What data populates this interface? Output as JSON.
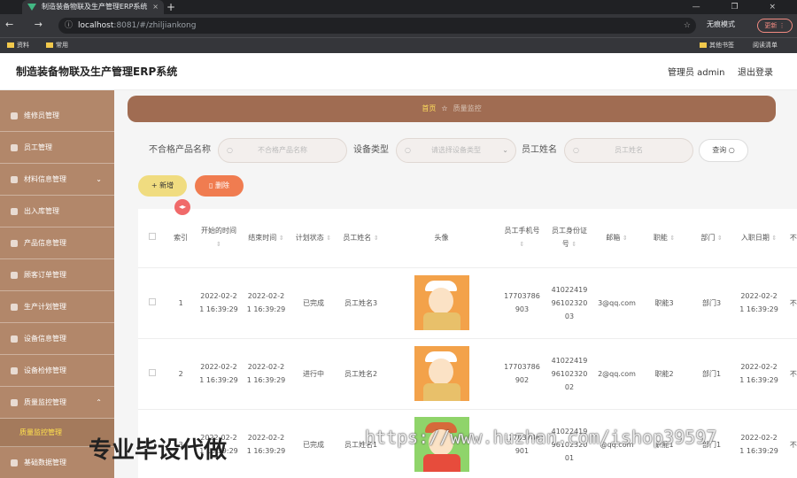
{
  "browser": {
    "tab_title": "制造装备物联及生产管理ERP系统",
    "tab_close": "×",
    "new_tab": "+",
    "window_controls": "—  ❐  ×",
    "nav": "← → ⟳",
    "url_host": "localhost",
    "url_path": ":8081/#/zhiljiankong",
    "info_icon": "ⓘ",
    "star_icon": "☆",
    "incognito_label": "无痕模式",
    "update_label": "更新 ⋮",
    "bookmarks": [
      {
        "label": "资料"
      },
      {
        "label": "常用"
      }
    ],
    "bookmarks_right": [
      {
        "label": "其他书签"
      },
      {
        "label": "阅读清单"
      }
    ]
  },
  "header": {
    "title": "制造装备物联及生产管理ERP系统",
    "admin": "管理员 admin",
    "logout": "退出登录"
  },
  "sidebar": {
    "items": [
      {
        "label": "维修员管理",
        "chevron": ""
      },
      {
        "label": "员工管理",
        "chevron": ""
      },
      {
        "label": "材料信息管理",
        "chevron": "⌄"
      },
      {
        "label": "出入库管理",
        "chevron": ""
      },
      {
        "label": "产品信息管理",
        "chevron": ""
      },
      {
        "label": "顾客订单管理",
        "chevron": ""
      },
      {
        "label": "生产计划管理",
        "chevron": ""
      },
      {
        "label": "设备信息管理",
        "chevron": ""
      },
      {
        "label": "设备检修管理",
        "chevron": ""
      },
      {
        "label": "质量监控管理",
        "chevron": "⌃"
      }
    ],
    "active_sub": "质量监控管理",
    "last_item": {
      "label": "基础数据管理",
      "chevron": ""
    }
  },
  "breadcrumb": {
    "home": "首页",
    "star": "☆",
    "current": "质量监控"
  },
  "search": {
    "label_product": "不合格产品名称",
    "placeholder_product": "不合格产品名称",
    "label_type": "设备类型",
    "placeholder_type": "请选择设备类型",
    "label_staff": "员工姓名",
    "placeholder_staff": "员工姓名",
    "query": "查询 ○",
    "mag_icon": "○",
    "dd_icon": "⌄"
  },
  "actions": {
    "add": "+ 新增",
    "delete": "▯ 删除",
    "resize": "◂▸"
  },
  "table": {
    "headers": {
      "index": "索引",
      "start": "开始的时间",
      "end": "结束时间",
      "status": "计划状态",
      "staff": "员工姓名",
      "avatar": "头像",
      "phone": "员工手机号",
      "idcard": "员工身份证号",
      "email": "邮箱",
      "role": "职能",
      "dept": "部门",
      "join": "入职日期",
      "more": "不合"
    },
    "sort_icon": "⇕",
    "rows": [
      {
        "index": "1",
        "start": "2022-02-21 16:39:29",
        "end": "2022-02-21 16:39:29",
        "status": "已完成",
        "staff": "员工姓名3",
        "phone": "17703786903",
        "idcard": "410224199610232003",
        "email": "3@qq.com",
        "role": "职能3",
        "dept": "部门3",
        "join": "2022-02-21 16:39:29",
        "more": "不品",
        "avatar_color": "#f3a24a"
      },
      {
        "index": "2",
        "start": "2022-02-21 16:39:29",
        "end": "2022-02-21 16:39:29",
        "status": "进行中",
        "staff": "员工姓名2",
        "phone": "17703786902",
        "idcard": "410224199610232002",
        "email": "2@qq.com",
        "role": "职能2",
        "dept": "部门1",
        "join": "2022-02-21 16:39:29",
        "more": "不品",
        "avatar_color": "#f3a24a"
      },
      {
        "index": "3",
        "start": "2022-02-21 16:39:29",
        "end": "2022-02-21 16:39:29",
        "status": "已完成",
        "staff": "员工姓名1",
        "phone": "17703786901",
        "idcard": "410224199610232001",
        "email": "@qq.com",
        "role": "职能1",
        "dept": "部门1",
        "join": "2022-02-21 16:39:29",
        "more": "不品",
        "avatar_color": "#8fd46a"
      }
    ]
  },
  "watermark": {
    "text": "专业毕设代做",
    "url": "https://www.huzhan.com/ishop39597"
  }
}
